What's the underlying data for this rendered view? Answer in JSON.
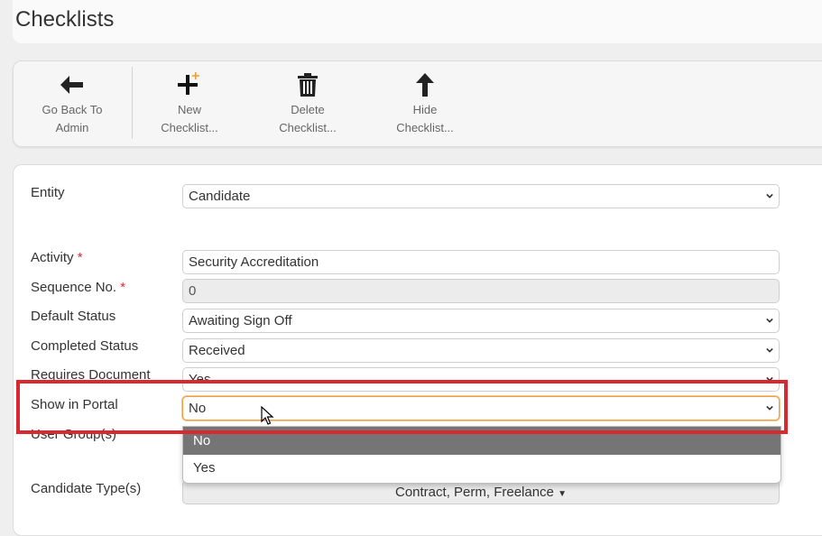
{
  "page": {
    "title": "Checklists"
  },
  "toolbar": {
    "back": "Go Back To\nAdmin",
    "new": "New\nChecklist...",
    "delete": "Delete\nChecklist...",
    "hide": "Hide\nChecklist..."
  },
  "form": {
    "entity": {
      "label": "Entity",
      "value": "Candidate"
    },
    "activity": {
      "label": "Activity",
      "required": "*",
      "value": "Security Accreditation"
    },
    "sequence": {
      "label": "Sequence No.",
      "required": "*",
      "value": "0"
    },
    "default_status": {
      "label": "Default Status",
      "value": "Awaiting Sign Off"
    },
    "completed_status": {
      "label": "Completed Status",
      "value": "Received"
    },
    "requires_document": {
      "label": "Requires Document",
      "value": "Yes"
    },
    "show_in_portal": {
      "label": "Show in Portal",
      "value": "No",
      "options": [
        "No",
        "Yes"
      ]
    },
    "user_groups": {
      "label": "User Group(s)"
    },
    "candidate_types": {
      "label": "Candidate Type(s)",
      "value": "Contract, Perm, Freelance"
    }
  },
  "colors": {
    "highlight": "#d9282f",
    "selected_option": "#757575",
    "required": "#d32f2f"
  }
}
